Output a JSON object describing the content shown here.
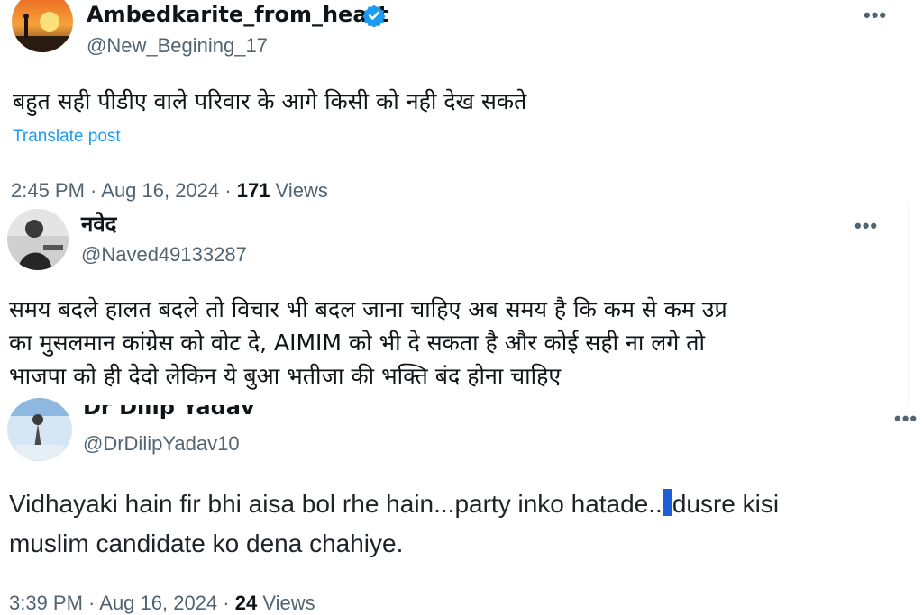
{
  "posts": [
    {
      "author_name": "Ambedkarite_from_heart",
      "verified": true,
      "handle": "@New_Begining_17",
      "text": "बहुत सही पीडीए वाले परिवार के आगे किसी को नही देख सकते",
      "translate_label": "Translate post",
      "time": "2:45 PM · Aug 16, 2024 · ",
      "views_count": "171",
      "views_label": " Views",
      "more_icon": "more-icon"
    },
    {
      "author_name": "नवेद",
      "handle": "@Naved49133287",
      "text_lines": [
        "समय बदले हालत बदले तो विचार भी बदल जाना चाहिए अब समय है कि कम से कम उप्र",
        "का मुसलमान कांग्रेस को वोट दे, AIMIM को भी दे सकता है और कोई सही ना लगे तो",
        "भाजपा को ही देदो लेकिन ये बुआ भतीजा की भक्ति बंद होना चाहिए"
      ],
      "more_icon": "more-icon"
    },
    {
      "author_name": "Dr Dilip Yadav",
      "handle": "@DrDilipYadav10",
      "text_line1_a": "Vidhayaki hain fir bhi aisa bol rhe hain...party inko hatade..",
      "text_line1_b": "dusre kisi",
      "text_line2": "muslim candidate ko dena chahiye.",
      "time": "3:39 PM · Aug 16, 2024 · ",
      "views_count": "24",
      "views_label": " Views",
      "more_icon": "more-icon"
    }
  ],
  "colors": {
    "accent": "#1d9bf0",
    "secondary_text": "#536471",
    "primary_text": "#0f1419"
  }
}
